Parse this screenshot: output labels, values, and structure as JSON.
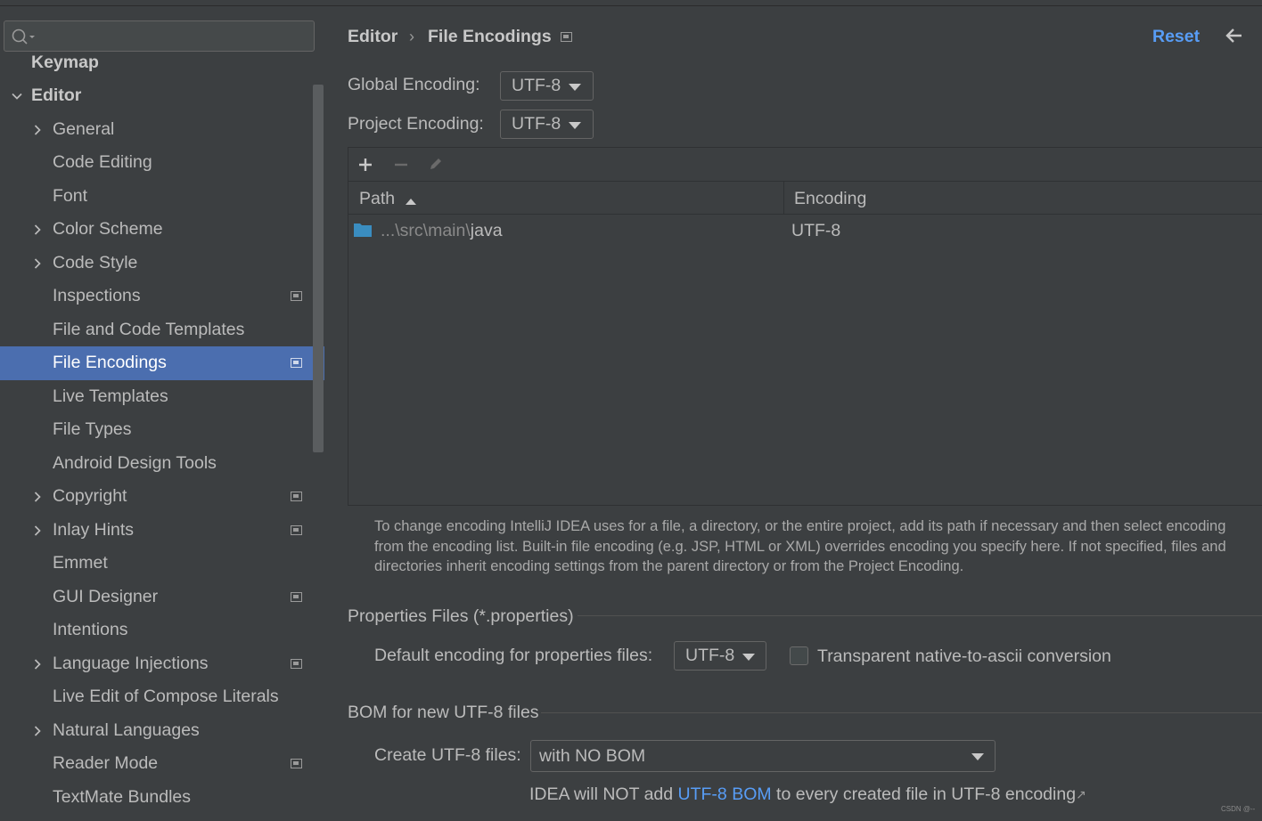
{
  "sidebar": {
    "search": {
      "value": "",
      "placeholder": ""
    },
    "items": [
      {
        "label": "Keymap"
      },
      {
        "label": "Editor"
      },
      {
        "label": "General"
      },
      {
        "label": "Code Editing"
      },
      {
        "label": "Font"
      },
      {
        "label": "Color Scheme"
      },
      {
        "label": "Code Style"
      },
      {
        "label": "Inspections"
      },
      {
        "label": "File and Code Templates"
      },
      {
        "label": "File Encodings"
      },
      {
        "label": "Live Templates"
      },
      {
        "label": "File Types"
      },
      {
        "label": "Android Design Tools"
      },
      {
        "label": "Copyright"
      },
      {
        "label": "Inlay Hints"
      },
      {
        "label": "Emmet"
      },
      {
        "label": "GUI Designer"
      },
      {
        "label": "Intentions"
      },
      {
        "label": "Language Injections"
      },
      {
        "label": "Live Edit of Compose Literals"
      },
      {
        "label": "Natural Languages"
      },
      {
        "label": "Reader Mode"
      },
      {
        "label": "TextMate Bundles"
      }
    ]
  },
  "header": {
    "breadcrumb_parent": "Editor",
    "breadcrumb_separator": "›",
    "breadcrumb_current": "File Encodings",
    "reset_label": "Reset",
    "back_arrow": "←"
  },
  "encodings": {
    "global_label": "Global Encoding:",
    "global_value": "UTF-8",
    "project_label": "Project Encoding:",
    "project_value": "UTF-8"
  },
  "table": {
    "columns": [
      "Path",
      "Encoding"
    ],
    "rows": [
      {
        "path_prefix": "...\\src\\main\\",
        "path_name": "java",
        "encoding": "UTF-8"
      }
    ]
  },
  "hint_lines": [
    "To change encoding IntelliJ IDEA uses for a file, a directory, or the entire project, add its path if necessary and then select encoding",
    "from the encoding list. Built-in file encoding (e.g. JSP, HTML or XML) overrides encoding you specify here. If not specified, files and",
    "directories inherit encoding settings from the parent directory or from the Project Encoding."
  ],
  "properties": {
    "section_title": "Properties Files (*.properties)",
    "default_label": "Default encoding for properties files:",
    "default_value": "UTF-8",
    "transparent_label": "Transparent native-to-ascii conversion",
    "transparent_checked": false
  },
  "bom": {
    "section_title": "BOM for new UTF-8 files",
    "create_label": "Create UTF-8 files:",
    "create_value": "with NO BOM",
    "note_before": "IDEA will NOT add ",
    "note_link": "UTF-8 BOM",
    "note_after": " to every created file in UTF-8 encoding",
    "note_ext_icon": "↗"
  },
  "watermark": "CSDN @--",
  "colors": {
    "background": "#3c3f41",
    "selection": "#4b6eaf",
    "link": "#589df6",
    "text": "#bbbbbb",
    "folder": "#3a8dc0"
  }
}
